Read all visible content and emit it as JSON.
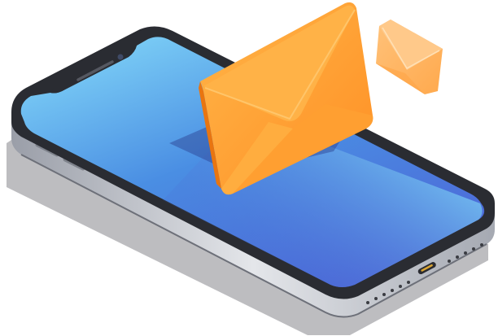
{
  "illustration": {
    "subject": "isometric-smartphone-with-email-envelopes",
    "icons": [
      "smartphone-icon",
      "envelope-icon"
    ],
    "colors": {
      "screen_top": "#7fd3f7",
      "screen_bottom": "#3a4fc8",
      "phone_body": "#2b2d33",
      "phone_frame": "#c9ccd3",
      "shadow": "#b5b5b8",
      "envelope_main": "#ff9a2e",
      "envelope_light": "#ffb24d",
      "envelope_dark": "#f07a12",
      "envelope_small": "#ffb362"
    }
  }
}
